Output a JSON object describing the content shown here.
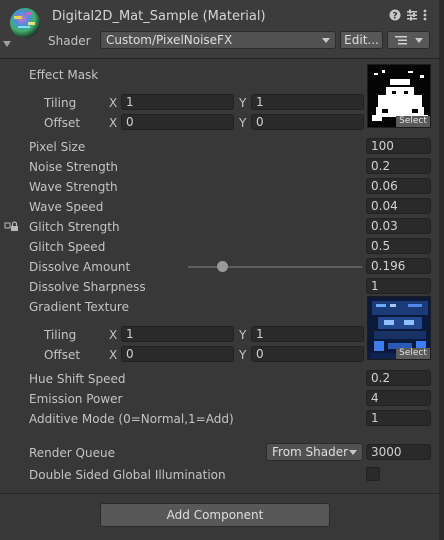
{
  "header": {
    "title": "Digital2D_Mat_Sample (Material)",
    "shader_label": "Shader",
    "shader_value": "Custom/PixelNoiseFX",
    "edit_label": "Edit..."
  },
  "effect_mask": {
    "label": "Effect Mask",
    "tiling_label": "Tiling",
    "offset_label": "Offset",
    "x_label": "X",
    "y_label": "Y",
    "tiling_x": "1",
    "tiling_y": "1",
    "offset_x": "0",
    "offset_y": "0",
    "select_label": "Select"
  },
  "properties": [
    {
      "label": "Pixel Size",
      "value": "100"
    },
    {
      "label": "Noise Strength",
      "value": "0.2"
    },
    {
      "label": "Wave Strength",
      "value": "0.06"
    },
    {
      "label": "Wave Speed",
      "value": "0.04"
    },
    {
      "label": "Glitch Strength",
      "value": "0.03"
    },
    {
      "label": "Glitch Speed",
      "value": "0.5"
    },
    {
      "label": "Dissolve Amount",
      "value": "0.196"
    },
    {
      "label": "Dissolve Sharpness",
      "value": "1"
    }
  ],
  "dissolve_slider_fraction": 0.196,
  "gradient_texture": {
    "label": "Gradient Texture",
    "tiling_label": "Tiling",
    "offset_label": "Offset",
    "x_label": "X",
    "y_label": "Y",
    "tiling_x": "1",
    "tiling_y": "1",
    "offset_x": "0",
    "offset_y": "0",
    "select_label": "Select"
  },
  "properties2": [
    {
      "label": "Hue Shift Speed",
      "value": "0.2"
    },
    {
      "label": "Emission Power",
      "value": "4"
    },
    {
      "label": "Additive Mode (0=Normal,1=Add)",
      "value": "1"
    }
  ],
  "render_queue": {
    "label": "Render Queue",
    "dropdown": "From Shader",
    "value": "3000"
  },
  "double_sided_gi": {
    "label": "Double Sided Global Illumination",
    "checked": false
  },
  "add_component_label": "Add Component",
  "colors": {
    "background": "#383838",
    "field": "#2a2a2a",
    "text": "#c4c4c4"
  }
}
